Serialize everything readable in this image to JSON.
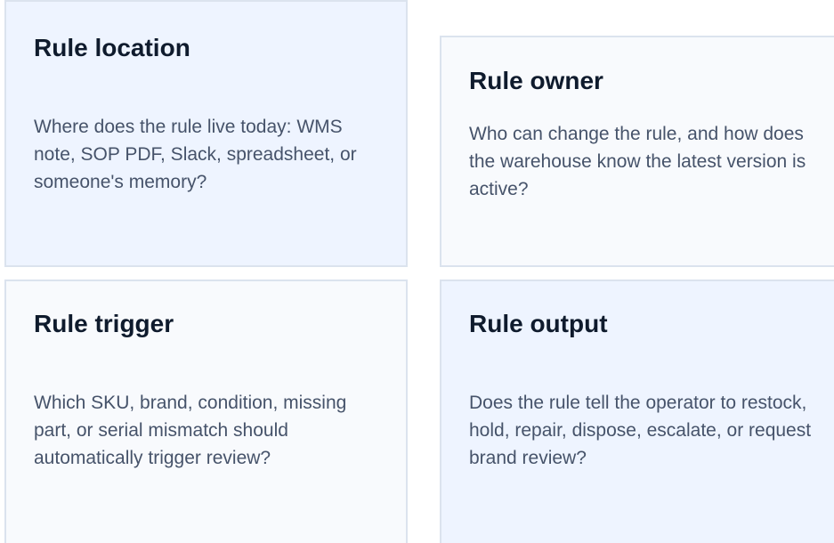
{
  "cards": [
    {
      "title": "Rule location",
      "body": "Where does the rule live today: WMS note, SOP PDF, Slack, spreadsheet, or someone's memory?"
    },
    {
      "title": "Rule owner",
      "body": "Who can change the rule, and how does the warehouse know the latest version is active?"
    },
    {
      "title": "Rule trigger",
      "body": "Which SKU, brand, condition, missing part, or serial mismatch should automatically trigger review?"
    },
    {
      "title": "Rule output",
      "body": "Does the rule tell the operator to restock, hold, repair, dispose, escalate, or request brand review?"
    }
  ],
  "colors": {
    "card_blue": "#eef4ff",
    "card_gray": "#f8fafd",
    "border": "#dbe3ee",
    "title": "#0f1b2d",
    "body": "#46536a"
  }
}
